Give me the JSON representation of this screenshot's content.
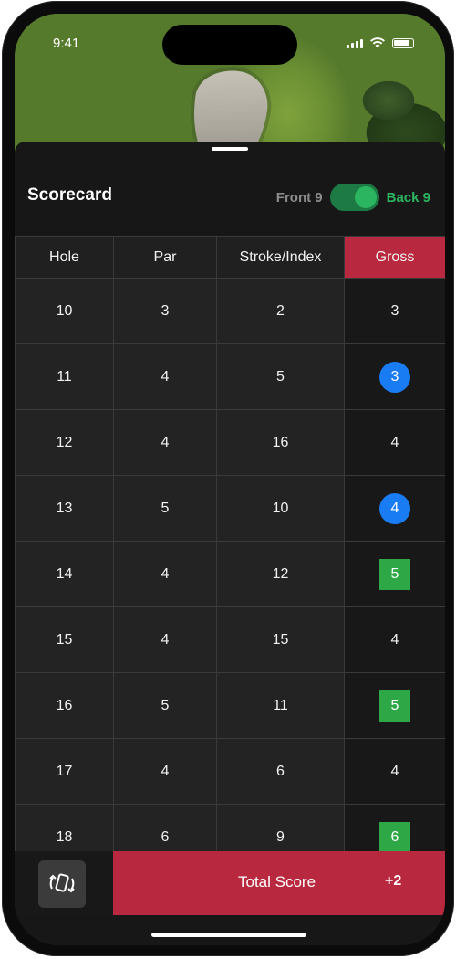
{
  "status_bar": {
    "time": "9:41"
  },
  "sheet": {
    "title": "Scorecard"
  },
  "toggle": {
    "front_label": "Front 9",
    "back_label": "Back 9",
    "selected": "Back 9"
  },
  "table": {
    "headers": [
      "Hole",
      "Par",
      "Stroke/Index",
      "Gross"
    ],
    "rows": [
      {
        "hole": "10",
        "par": "3",
        "index": "2",
        "gross": "3",
        "gross_style": "plain"
      },
      {
        "hole": "11",
        "par": "4",
        "index": "5",
        "gross": "3",
        "gross_style": "circle"
      },
      {
        "hole": "12",
        "par": "4",
        "index": "16",
        "gross": "4",
        "gross_style": "plain"
      },
      {
        "hole": "13",
        "par": "5",
        "index": "10",
        "gross": "4",
        "gross_style": "circle"
      },
      {
        "hole": "14",
        "par": "4",
        "index": "12",
        "gross": "5",
        "gross_style": "square"
      },
      {
        "hole": "15",
        "par": "4",
        "index": "15",
        "gross": "4",
        "gross_style": "plain"
      },
      {
        "hole": "16",
        "par": "5",
        "index": "11",
        "gross": "5",
        "gross_style": "square"
      },
      {
        "hole": "17",
        "par": "4",
        "index": "6",
        "gross": "4",
        "gross_style": "plain"
      },
      {
        "hole": "18",
        "par": "6",
        "index": "9",
        "gross": "6",
        "gross_style": "square"
      }
    ]
  },
  "footer": {
    "total_label": "Total Score",
    "total_value": "+2",
    "rotate_icon": "rotate-device-icon"
  },
  "colors": {
    "accent_red": "#b8283e",
    "birdie_blue": "#1a7cf2",
    "bogey_green": "#2ea846",
    "toggle_green": "#2bb560"
  }
}
